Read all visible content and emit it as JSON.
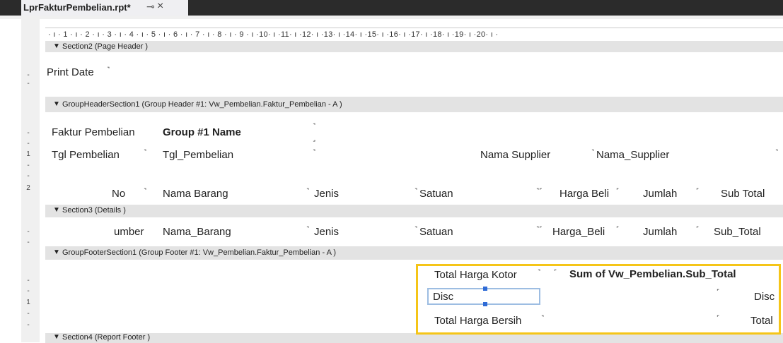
{
  "tab": {
    "title": "LprFakturPembelian.rpt*",
    "pin_icon": "pin-icon",
    "close_icon": "×"
  },
  "ruler": {
    "text": "· ı · 1 · ı · 2 · ı · 3 · ı · 4 · ı · 5 · ı · 6 · ı · 7 · ı · 8 · ı · 9 · ı ·10· ı ·11· ı ·12· ı ·13· ı ·14· ı ·15· ı ·16· ı ·17· ı ·18· ı ·19· ı ·20· ı ·"
  },
  "bands": {
    "page_header": "Section2 (Page Header )",
    "group_header": "GroupHeaderSection1 (Group Header #1: Vw_Pembelian.Faktur_Pembelian - A )",
    "details": "Section3 (Details )",
    "group_footer": "GroupFooterSection1 (Group Footer #1: Vw_Pembelian.Faktur_Pembelian - A )",
    "report_footer": "Section4 (Report Footer )"
  },
  "gutter": {
    "g1": "-",
    "g2": "-",
    "g3": "1",
    "g4": "2"
  },
  "fields": {
    "print_date": "Print Date",
    "faktur_label": "Faktur Pembelian",
    "group_name": "Group #1 Name",
    "tgl_label": "Tgl Pembelian",
    "tgl_field": "Tgl_Pembelian",
    "supplier_label": "Nama Supplier",
    "supplier_field": "Nama_Supplier",
    "col_no": "No",
    "col_nama": "Nama Barang",
    "col_jenis": "Jenis",
    "col_satuan": "Satuan",
    "col_harga": "Harga Beli",
    "col_jumlah": "Jumlah",
    "col_subtotal": "Sub Total",
    "det_no": "umber",
    "det_nama": "Nama_Barang",
    "det_jenis": "Jenis",
    "det_satuan": "Satuan",
    "det_harga": "Harga_Beli",
    "det_jumlah": "Jumlah",
    "det_subtotal": "Sub_Total",
    "total_kotor_label": "Total Harga Kotor",
    "sum_field": "Sum of Vw_Pembelian.Sub_Total",
    "disc_label": "Disc",
    "disc_field": "Disc",
    "total_bersih_label": "Total Harga Bersih",
    "total_field": "Total"
  },
  "colors": {
    "highlight": "#f5c518",
    "selection": "#2f6bd6",
    "tabbar": "#2b2b2b",
    "band": "#e3e3e3"
  }
}
